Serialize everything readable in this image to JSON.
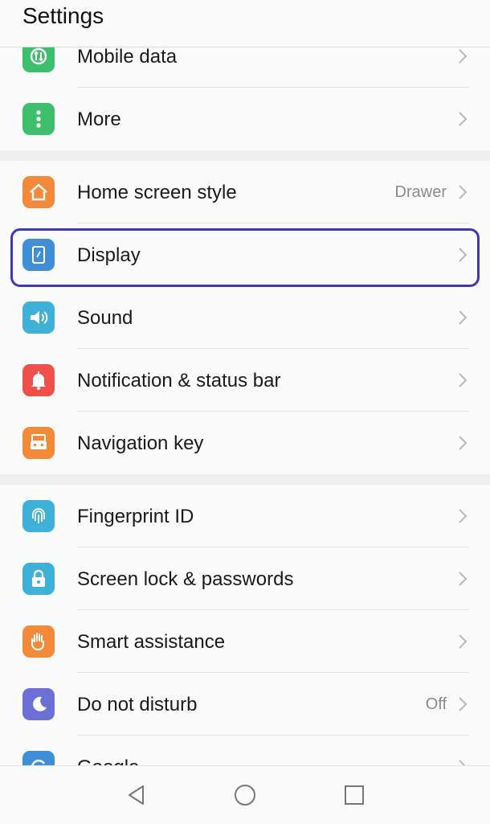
{
  "header": {
    "title": "Settings"
  },
  "items": [
    {
      "label": "Mobile data",
      "value": "",
      "icon": "mobile-data-icon",
      "color": "#3dbf6e"
    },
    {
      "label": "More",
      "value": "",
      "icon": "more-dots-icon",
      "color": "#3dbf6e"
    },
    {
      "label": "Home screen style",
      "value": "Drawer",
      "icon": "home-icon",
      "color": "#f28a3a"
    },
    {
      "label": "Display",
      "value": "",
      "icon": "display-icon",
      "color": "#3f8ed8"
    },
    {
      "label": "Sound",
      "value": "",
      "icon": "speaker-icon",
      "color": "#3fb1d8"
    },
    {
      "label": "Notification & status bar",
      "value": "",
      "icon": "bell-icon",
      "color": "#f0504a"
    },
    {
      "label": "Navigation key",
      "value": "",
      "icon": "navigation-key-icon",
      "color": "#f28a3a"
    },
    {
      "label": "Fingerprint ID",
      "value": "",
      "icon": "fingerprint-icon",
      "color": "#3fb1d8"
    },
    {
      "label": "Screen lock & passwords",
      "value": "",
      "icon": "lock-icon",
      "color": "#3fb1d8"
    },
    {
      "label": "Smart assistance",
      "value": "",
      "icon": "hand-icon",
      "color": "#f28a3a"
    },
    {
      "label": "Do not disturb",
      "value": "Off",
      "icon": "moon-icon",
      "color": "#6b6fd6"
    },
    {
      "label": "Google",
      "value": "",
      "icon": "google-icon",
      "color": "#3f8ed8"
    }
  ],
  "navbar": {
    "back": "back-icon",
    "home": "home-circle-icon",
    "recents": "recents-square-icon"
  },
  "highlight_color": "#3a3ab8"
}
